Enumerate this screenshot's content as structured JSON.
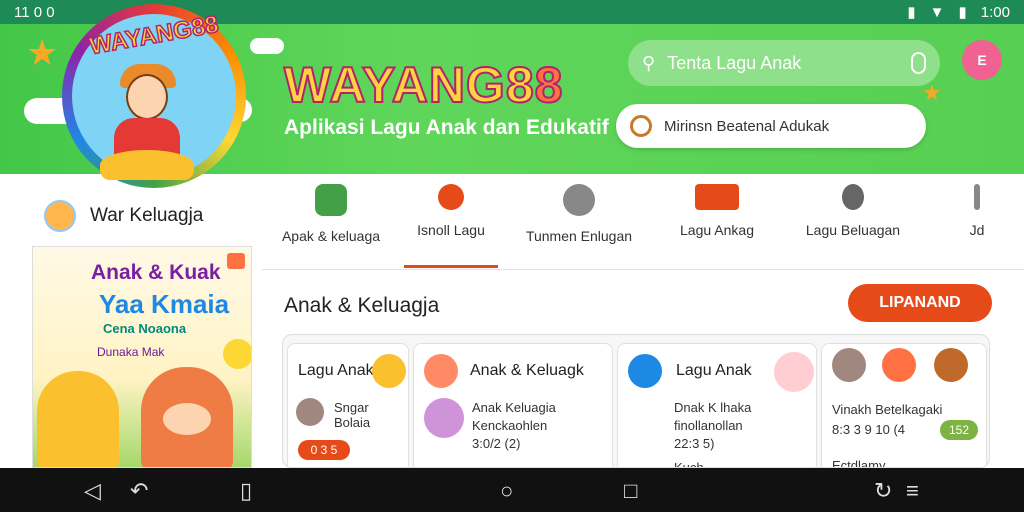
{
  "statusbar": {
    "left": "11 0 0",
    "time": "1:00",
    "icons": [
      "vibrate-icon",
      "wifi-icon",
      "battery-icon"
    ]
  },
  "header": {
    "logo_text": "WAYANG88",
    "brand_main": "WAYANG8",
    "brand_tail": "8",
    "tagline": "Aplikasi Lagu Anak dan Edukatif",
    "search": {
      "placeholder": "Tenta Lagu Anak"
    },
    "secondary_search": "Mirinsn Beatenal Adukak",
    "avatar_label": "E"
  },
  "sidebar": {
    "profile_name": "War Keluagja",
    "promo": {
      "line1": "Anak & Kuak",
      "line2": "Yaa Kmaia",
      "line3": "Cena Noaona",
      "line4": "Dunaka Mak"
    }
  },
  "tabs": [
    {
      "label": "Apak & keluaga"
    },
    {
      "label": "Isnoll Lagu"
    },
    {
      "label": "Tunmen Enlugan"
    },
    {
      "label": "Lagu Ankag"
    },
    {
      "label": "Lagu Beluagan"
    },
    {
      "label": "Jd"
    }
  ],
  "main": {
    "title": "Anak & Keluagja",
    "more_button": "LIPANAND"
  },
  "cards": [
    {
      "title": "Lagu Anak",
      "item_title": "Sngar Bolaia",
      "meta": "",
      "chip": "0 3 5"
    },
    {
      "title": "Anak & Keluagk",
      "item_title": "Anak Keluagia",
      "item_sub": "Kenckaohlen",
      "meta": "3:0/2 (2)"
    },
    {
      "title": "Lagu Anak",
      "item_title": "Dnak K lhaka",
      "item_sub": "finollanollan",
      "meta": "22:3 5)",
      "foot": "Kuch"
    },
    {
      "title": "",
      "item_title": "Vinakh Betelkagaki",
      "meta": "8:3 3 9 10 (4",
      "chip": "152",
      "foot": "Ectdlamy"
    }
  ],
  "colors": {
    "accent": "#e64a19",
    "header_green": "#4cc94a",
    "status_green": "#1e8a55"
  }
}
